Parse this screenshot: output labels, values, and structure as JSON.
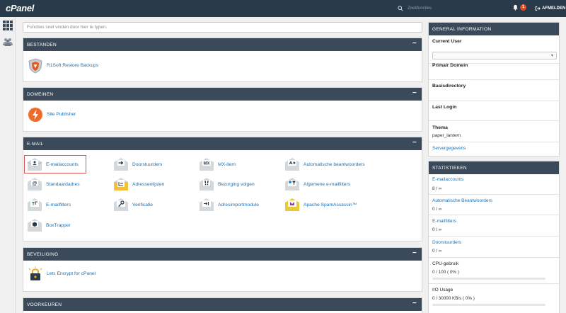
{
  "topbar": {
    "logo": "cPanel",
    "search_placeholder": "Zoekfuncties",
    "notification_count": "1",
    "logout_label": "AFMELDEN"
  },
  "search": {
    "placeholder": "Functies snel vinden door hier te typen."
  },
  "sections": {
    "bestanden": {
      "title": "BESTANDEN",
      "items": [
        "R1Soft Restore Backups"
      ]
    },
    "domeinen": {
      "title": "DOMEINEN",
      "items": [
        "Site Publisher"
      ]
    },
    "email": {
      "title": "E-MAIL",
      "items": [
        "E-mailaccounts",
        "Doorstuurders",
        "MX-item",
        "Automatische beantwoorders",
        "Standaardadres",
        "Adressenlijsten",
        "Bezorging volgen",
        "Algemene e-mailfilters",
        "E-mailfilters",
        "Verificatie",
        "Adresimportmodule",
        "Apache SpamAssassin™",
        "BoxTrapper"
      ]
    },
    "beveiliging": {
      "title": "BEVEILIGING",
      "items": [
        "Lets Encrypt for cPanel"
      ]
    },
    "voorkeuren": {
      "title": "VOORKEUREN"
    }
  },
  "general_info": {
    "title": "GENERAL INFORMATION",
    "current_user_label": "Current User",
    "current_user_value": "",
    "primary_domain_label": "Primair Domein",
    "home_dir_label": "Basisdirectory",
    "last_login_label": "Last Login",
    "theme_label": "Thema",
    "theme_value": "paper_lantern",
    "server_info_link": "Servergegevens"
  },
  "stats": {
    "title": "STATISTIEKEN",
    "items": [
      {
        "label": "E-mailaccounts",
        "value": "8 / ∞",
        "link": true
      },
      {
        "label": "Automatische Beantwoorders",
        "value": "0 / ∞",
        "link": true
      },
      {
        "label": "E-mailfilters",
        "value": "0 / ∞",
        "link": true
      },
      {
        "label": "Doorstuurders",
        "value": "0 / ∞",
        "link": true
      },
      {
        "label": "CPU-gebruik",
        "value": "0 / 100   ( 0% )",
        "link": false,
        "percent": 0
      },
      {
        "label": "I/O Usage",
        "value": "0 / 30000 KB/s   ( 0% )",
        "link": false,
        "percent": 0
      }
    ]
  },
  "colors": {
    "topbar": "#293a4a",
    "panel_header": "#3a4a5a",
    "link": "#1f6fb0",
    "accent": "#e64b1e",
    "highlight": "#e05353"
  }
}
